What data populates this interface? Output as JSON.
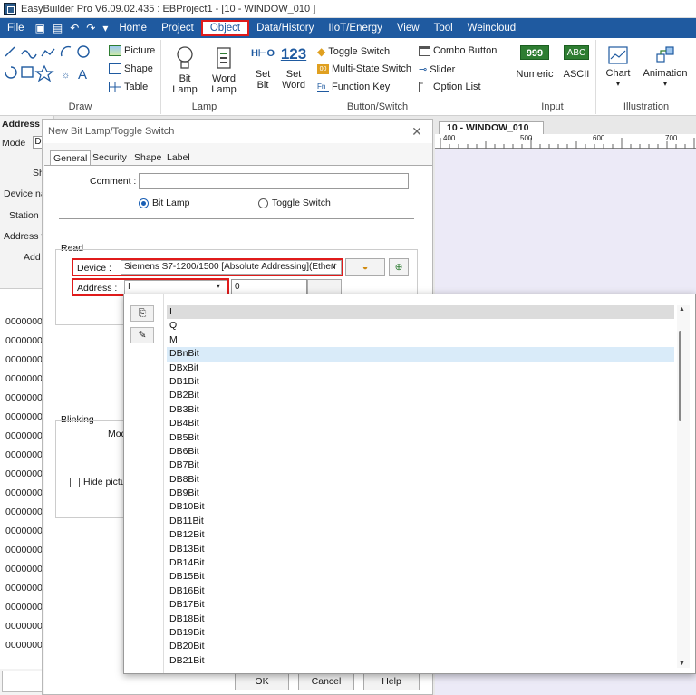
{
  "window": {
    "title": "EasyBuilder Pro V6.09.02.435 : EBProject1 - [10 - WINDOW_010 ]"
  },
  "menu": {
    "items": [
      "File",
      "Home",
      "Project",
      "Object",
      "Data/History",
      "IIoT/Energy",
      "View",
      "Tool",
      "Weincloud"
    ],
    "active": "Object"
  },
  "ribbon": {
    "draw": {
      "label": "Draw",
      "picture": "Picture",
      "shape": "Shape",
      "table": "Table"
    },
    "lamp": {
      "label": "Lamp",
      "bit_lamp": "Bit Lamp",
      "word_lamp": "Word Lamp"
    },
    "button_switch": {
      "label": "Button/Switch",
      "set_bit": "Set Bit",
      "set_word": "Set Word",
      "toggle_switch": "Toggle Switch",
      "multi_state_switch": "Multi-State Switch",
      "function_key": "Function Key",
      "combo_button": "Combo Button",
      "slider": "Slider",
      "option_list": "Option List"
    },
    "input": {
      "label": "Input",
      "numeric": "Numeric",
      "ascii": "ASCII",
      "numeric_glyph": "999",
      "ascii_glyph": "ABC"
    },
    "illustration": {
      "label": "Illustration",
      "chart": "Chart",
      "animation": "Animation"
    }
  },
  "left_panel": {
    "address": "Address",
    "mode": "Mode",
    "mode_box": "D",
    "labels": [
      "Sh",
      "Device na",
      "Station",
      "Address t",
      "Add"
    ],
    "rows": [
      "0000000",
      "0000000",
      "0000000",
      "0000000",
      "0000000",
      "0000000",
      "0000000",
      "0000000",
      "0000000",
      "0000000",
      "0000000",
      "0000000",
      "0000000",
      "0000000",
      "0000000",
      "0000000",
      "0000000",
      "0000000",
      "0000000"
    ]
  },
  "canvas": {
    "tab": "10 - WINDOW_010",
    "ruler_ticks": [
      "400",
      "500",
      "600",
      "700"
    ]
  },
  "dialog": {
    "title": "New Bit Lamp/Toggle Switch",
    "tabs": [
      "General",
      "Security",
      "Shape",
      "Label"
    ],
    "comment_label": "Comment :",
    "comment_value": "",
    "radio_bit_lamp": "Bit Lamp",
    "radio_toggle_switch": "Toggle Switch",
    "read_label": "Read",
    "device_label": "Device :",
    "device_value": "Siemens S7-1200/1500 [Absolute Addressing](Etherr",
    "address_label": "Address :",
    "address_value": "I",
    "address_number": "0",
    "blinking_label": "Blinking",
    "mode_label": "Mod",
    "hide_picture": "Hide picture",
    "ok": "OK",
    "cancel": "Cancel",
    "help": "Help"
  },
  "dropdown": {
    "items": [
      "I",
      "Q",
      "M",
      "DBnBit",
      "DBxBit",
      "DB1Bit",
      "DB2Bit",
      "DB3Bit",
      "DB4Bit",
      "DB5Bit",
      "DB6Bit",
      "DB7Bit",
      "DB8Bit",
      "DB9Bit",
      "DB10Bit",
      "DB11Bit",
      "DB12Bit",
      "DB13Bit",
      "DB14Bit",
      "DB15Bit",
      "DB16Bit",
      "DB17Bit",
      "DB18Bit",
      "DB19Bit",
      "DB20Bit",
      "DB21Bit"
    ],
    "selected": "I",
    "hovered": "DBnBit"
  },
  "colors": {
    "menubar": "#1f5aa0",
    "highlight": "#e01b1b",
    "canvas": "#eceaf7"
  }
}
